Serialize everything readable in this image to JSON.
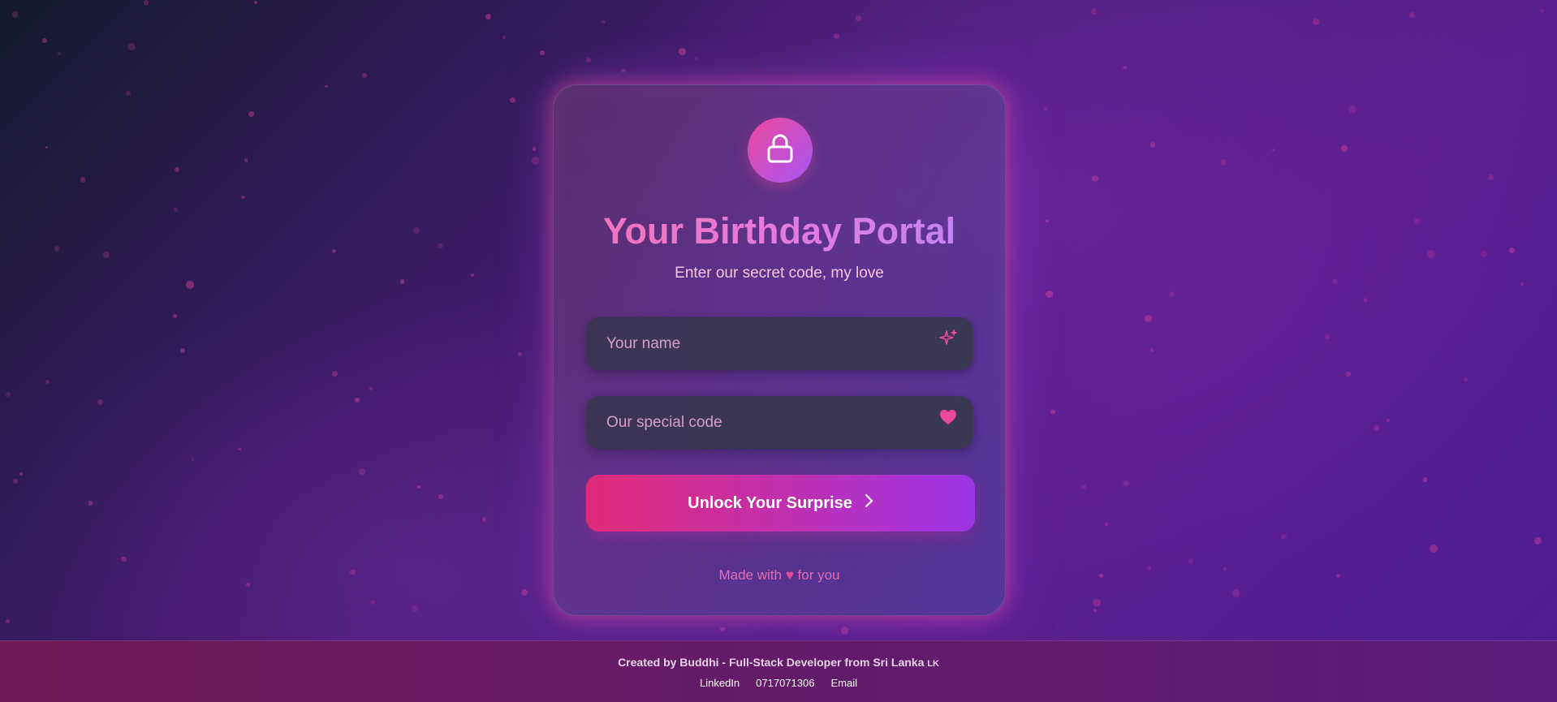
{
  "card": {
    "title": "Your Birthday Portal",
    "subtitle": "Enter our secret code, my love",
    "lock_icon": "lock-icon",
    "name_field": {
      "placeholder": "Your name",
      "value": "",
      "icon": "sparkle-icon"
    },
    "code_field": {
      "placeholder": "Our special code",
      "value": "",
      "icon": "heart-icon"
    },
    "unlock_button": {
      "label": "Unlock Your Surprise",
      "icon": "chevron-right-icon"
    },
    "made_with": {
      "before": "Made with",
      "heart": "♥",
      "after": "for you"
    }
  },
  "footer": {
    "credit": "Created by Buddhi - Full-Stack Developer from Sri Lanka",
    "flag": "LK",
    "links": [
      "LinkedIn",
      "0717071306",
      "Email"
    ]
  },
  "colors": {
    "accent_pink": "#ec4899",
    "accent_purple": "#a855f7",
    "background_deep": "#4a1c79"
  }
}
